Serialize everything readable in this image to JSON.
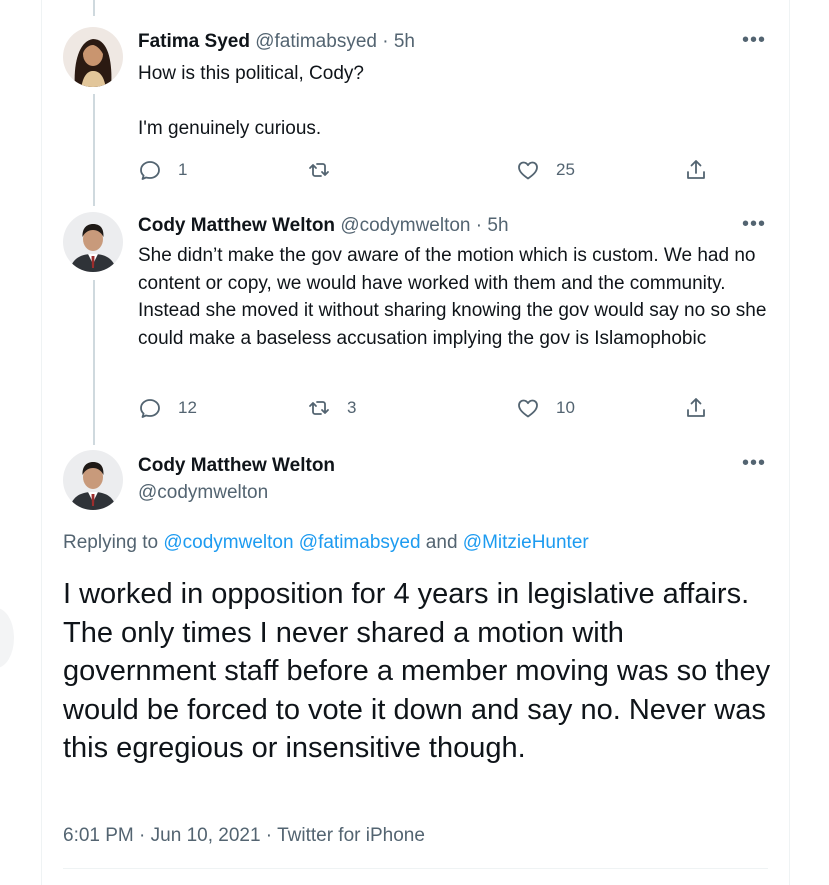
{
  "colors": {
    "text_primary": "#0f1419",
    "text_secondary": "#536471",
    "link": "#1d9bf0",
    "thread_line": "#cfd9de"
  },
  "tweets": [
    {
      "name": "Fatima Syed",
      "handle": "@fatimabsyed",
      "separator": " · ",
      "time": "5h",
      "more_label": "•••",
      "text": "How is this political, Cody?\n\nI'm genuinely curious.",
      "actions": {
        "reply_icon": "reply-icon",
        "reply_count": "1",
        "retweet_icon": "retweet-icon",
        "retweet_count": "",
        "like_icon": "heart-icon",
        "like_count": "25",
        "share_icon": "share-icon"
      }
    },
    {
      "name": "Cody Matthew Welton",
      "handle": "@codymwelton",
      "separator": " · ",
      "time": "5h",
      "more_label": "•••",
      "text": "She didn’t make the gov aware of the motion which is custom. We had no content or copy, we would have worked with them and the community. Instead she moved it without sharing knowing the gov would say no so she could make a baseless accusation implying the gov is Islamophobic",
      "actions": {
        "reply_icon": "reply-icon",
        "reply_count": "12",
        "retweet_icon": "retweet-icon",
        "retweet_count": "3",
        "like_icon": "heart-icon",
        "like_count": "10",
        "share_icon": "share-icon"
      }
    }
  ],
  "main_tweet": {
    "name": "Cody Matthew Welton",
    "handle": "@codymwelton",
    "more_label": "•••",
    "replying_prefix": "Replying to ",
    "replying_users": [
      "@codymwelton",
      "@fatimabsyed"
    ],
    "replying_and": " and ",
    "replying_last": "@MitzieHunter",
    "text": "I worked in opposition for 4 years in legislative affairs. The only times I never shared a motion with government staff before a member moving was so they would be forced to vote it down and say no. Never was this egregious or insensitive though.",
    "time": "6:01 PM",
    "separator": " · ",
    "date": "Jun 10, 2021",
    "source": "Twitter for iPhone"
  }
}
